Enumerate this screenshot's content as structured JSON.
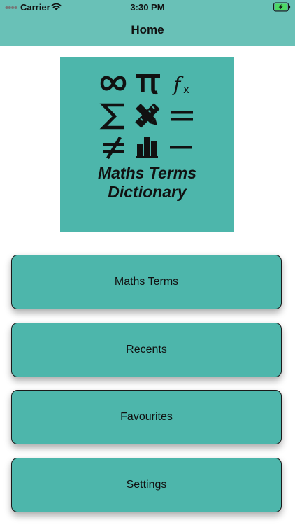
{
  "status_bar": {
    "carrier": "Carrier",
    "time": "3:30 PM",
    "battery_state": "charging"
  },
  "nav": {
    "title": "Home"
  },
  "logo": {
    "icons": [
      "infinity-icon",
      "pi-icon",
      "function-icon",
      "sigma-icon",
      "ruler-pencil-icon",
      "equals-icon",
      "not-equal-icon",
      "bar-chart-icon",
      "minus-icon"
    ],
    "title_line1": "Maths Terms",
    "title_line2": "Dictionary"
  },
  "menu": {
    "items": [
      {
        "label": "Maths Terms"
      },
      {
        "label": "Recents"
      },
      {
        "label": "Favourites"
      },
      {
        "label": "Settings"
      }
    ]
  },
  "colors": {
    "header": "#69c1b7",
    "teal": "#4db6ab",
    "battery_charging": "#4cd964"
  }
}
